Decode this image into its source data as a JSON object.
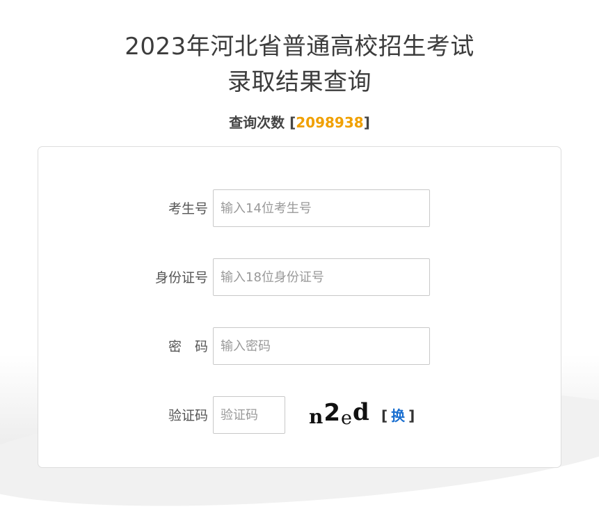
{
  "header": {
    "title_line1": "2023年河北省普通高校招生考试",
    "title_line2": "录取结果查询"
  },
  "query_count": {
    "label": "查询次数",
    "open_bracket": "[",
    "value": "2098938",
    "close_bracket": "]"
  },
  "form": {
    "exam_id": {
      "label": "考生号",
      "placeholder": "输入14位考生号"
    },
    "id_card": {
      "label": "身份证号",
      "placeholder": "输入18位身份证号"
    },
    "password": {
      "label": "密　码",
      "placeholder": "输入密码"
    },
    "captcha": {
      "label": "验证码",
      "placeholder": "验证码",
      "image_text": [
        "n",
        "2",
        "e",
        "d"
      ],
      "refresh_open": "[",
      "refresh_label": "换",
      "refresh_close": "]"
    }
  },
  "colors": {
    "count_highlight": "#f0a000",
    "link": "#1a6fd0"
  }
}
